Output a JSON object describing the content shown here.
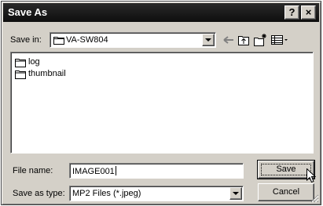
{
  "window": {
    "title": "Save As"
  },
  "titlebar_buttons": {
    "help": "?",
    "close": "×"
  },
  "save_in": {
    "label": "Save in:",
    "value": "VA-SW804"
  },
  "files": [
    {
      "name": "log",
      "icon": "folder-icon"
    },
    {
      "name": "thumbnail",
      "icon": "folder-icon"
    }
  ],
  "file_name": {
    "label": "File name:",
    "value": "IMAGE001"
  },
  "save_as_type": {
    "label": "Save as type:",
    "value": "MP2 Files (*.jpeg)"
  },
  "buttons": {
    "save": "Save",
    "cancel": "Cancel"
  },
  "toolbar": [
    "back-arrow-icon",
    "up-folder-icon",
    "new-folder-icon",
    "view-menu-icon"
  ],
  "colors": {
    "dialog": "#d4d0c8",
    "titlebar": "#1a1a1a"
  }
}
